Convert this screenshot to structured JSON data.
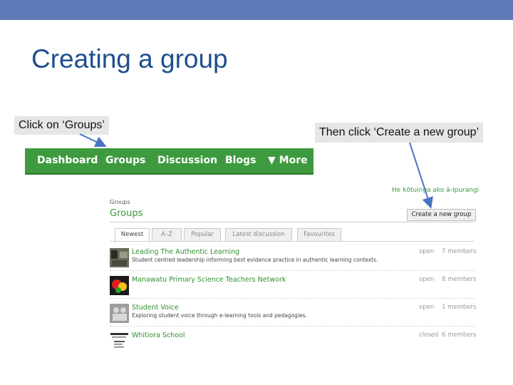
{
  "slide": {
    "title": "Creating a group",
    "callout_left": "Click on ‘Groups’",
    "callout_right": "Then click ‘Create a new group’"
  },
  "nav": {
    "items": [
      "Dashboard",
      "Groups",
      "Discussion",
      "Blogs",
      "▼ More"
    ],
    "active_color": "#3e9a3e"
  },
  "page": {
    "breadcrumb": "Groups",
    "heading": "Groups",
    "maori_link": "He kōtuinga ako ā-Ipurangi",
    "create_button": "Create a new group"
  },
  "tabs": [
    "Newest",
    "A–Z",
    "Popular",
    "Latest discussion",
    "Favourites"
  ],
  "groups": [
    {
      "title": "Leading The Authentic Learning",
      "description": "Student centred leadership informing best evidence practice in authentic learning contexts.",
      "status": "open",
      "members": "7 members",
      "thumb": "photo-thumbnail-icon"
    },
    {
      "title": "Manawatu Primary Science Teachers Network",
      "description": "",
      "status": "open",
      "members": "8 members",
      "thumb": "science-logo-icon"
    },
    {
      "title": "Student Voice",
      "description": "Exploring student voice through e-learning tools and pedagogies.",
      "status": "open",
      "members": "1 members",
      "thumb": "people-placeholder-icon"
    },
    {
      "title": "Whitiora School",
      "description": "",
      "status": "closed",
      "members": "6 members",
      "thumb": "school-logo-icon"
    }
  ],
  "colors": {
    "topbar": "#6079b8",
    "title": "#1f4e8c",
    "nav_green": "#3e9a3e",
    "link_green": "#2f8f2f",
    "arrow": "#4a72c4"
  }
}
